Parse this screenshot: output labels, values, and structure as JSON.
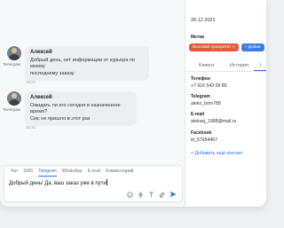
{
  "messages": [
    {
      "author": "Алексей",
      "role": "Телеграм",
      "lines": [
        "Добрый день, нет информации от курьера по моему",
        "последнему заказу"
      ],
      "time": "10:41"
    },
    {
      "author": "Алексей",
      "role": "Телеграм",
      "lines": [
        "Ожидать ли его сегодня в назначенное время?",
        "Смс не пришло в этот раз"
      ],
      "time": "10:41"
    }
  ],
  "composer": {
    "tabs": [
      "Чат",
      "SMS",
      "Telegram",
      "WhatsApp",
      "E-mail",
      "Комментарий"
    ],
    "active_tab": "Telegram",
    "draft": "Добрый день! Да, ваш заказ уже в пути"
  },
  "toolbar_icons": [
    "emoji-icon",
    "lightning-icon",
    "text-format-icon",
    "attach-icon",
    "send-icon"
  ],
  "contact": {
    "date": "28.12.2021",
    "tags_label": "Метки",
    "tags": [
      {
        "label": "Высокий приоритет",
        "color": "#e8593c",
        "icon": "close-icon"
      },
      {
        "label": "+ Добав",
        "color": "#3b7be6"
      }
    ],
    "tabs": [
      "Клиент",
      "История",
      "I"
    ],
    "phone_label": "Телефон",
    "phone": "+7 916 543 09 89",
    "telegram_label": "Telegram",
    "telegram": "aleks_bom789",
    "email_label": "E-mail",
    "email": "aleksej_1988@mail.ru",
    "facebook_label": "Facebook",
    "facebook": "id_67654467",
    "add_contact": "+ Добавить ещё контакт"
  }
}
